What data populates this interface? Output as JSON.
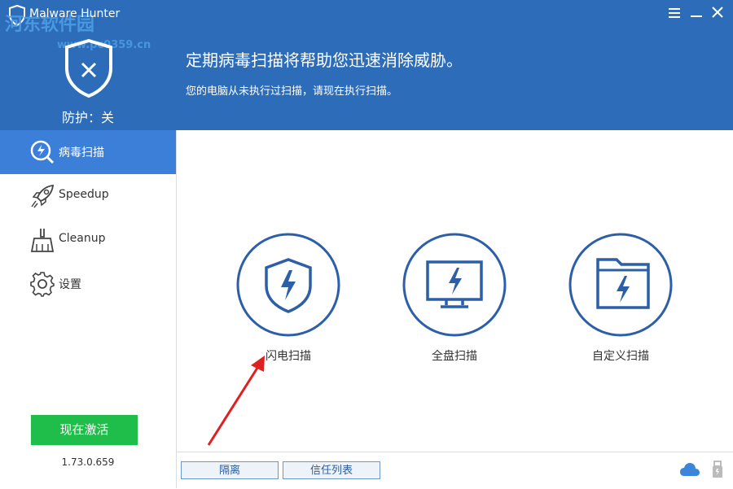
{
  "window": {
    "title": "Malware Hunter",
    "watermark": "河东软件园",
    "watermark_url": "www.pc0359.cn",
    "menu_icon": "menu-icon",
    "minimize_icon": "minimize-icon",
    "close_icon": "close-icon"
  },
  "header": {
    "protection_label": "防护：关",
    "headline": "定期病毒扫描将帮助您迅速消除威胁。",
    "subline": "您的电脑从未执行过扫描，请现在执行扫描。"
  },
  "sidebar": {
    "items": [
      {
        "label": "病毒扫描",
        "icon": "virus-scan-icon",
        "active": true
      },
      {
        "label": "Speedup",
        "icon": "rocket-icon",
        "active": false
      },
      {
        "label": "Cleanup",
        "icon": "broom-icon",
        "active": false
      },
      {
        "label": "设置",
        "icon": "gear-icon",
        "active": false
      }
    ],
    "activate_label": "现在激活",
    "version": "1.73.0.659"
  },
  "scan_options": [
    {
      "label": "闪电扫描",
      "icon": "shield-lightning-icon"
    },
    {
      "label": "全盘扫描",
      "icon": "monitor-lightning-icon"
    },
    {
      "label": "自定义扫描",
      "icon": "folder-lightning-icon"
    }
  ],
  "bottom_bar": {
    "quarantine_label": "隔离",
    "trust_list_label": "信任列表"
  },
  "colors": {
    "header_bg": "#2d6cb8",
    "active_nav": "#3c7fd8",
    "activate_green": "#1fbe4a",
    "icon_blue": "#2c5fa8"
  }
}
